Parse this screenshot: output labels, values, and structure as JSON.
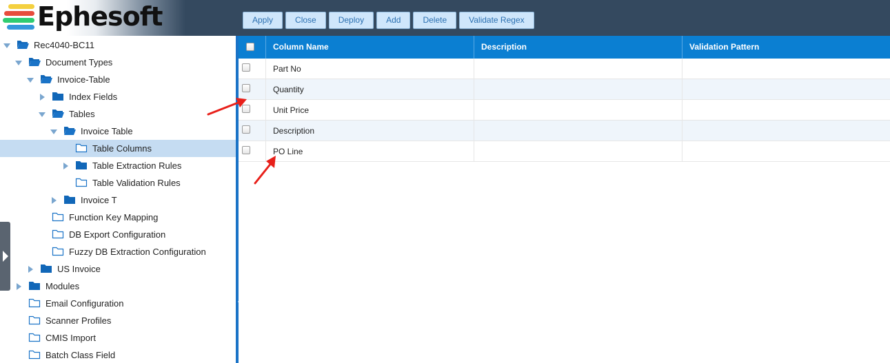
{
  "app": {
    "logo_text": "Ephesoft",
    "logo_colors": [
      "#f4d03f",
      "#e74c3c",
      "#2ecc71",
      "#3498db"
    ]
  },
  "toolbar": {
    "buttons": [
      "Apply",
      "Close",
      "Deploy",
      "Add",
      "Delete",
      "Validate Regex"
    ]
  },
  "tree": {
    "items": [
      {
        "label": "Rec4040-BC11",
        "level": 0,
        "state": "open"
      },
      {
        "label": "Document Types",
        "level": 1,
        "state": "open"
      },
      {
        "label": "Invoice-Table",
        "level": 2,
        "state": "open"
      },
      {
        "label": "Index Fields",
        "level": 3,
        "state": "closed"
      },
      {
        "label": "Tables",
        "level": 3,
        "state": "open"
      },
      {
        "label": "Invoice Table",
        "level": 4,
        "state": "open"
      },
      {
        "label": "Table Columns",
        "level": 5,
        "state": "leaf",
        "selected": true
      },
      {
        "label": "Table Extraction Rules",
        "level": 5,
        "state": "closed"
      },
      {
        "label": "Table Validation Rules",
        "level": 5,
        "state": "leaf"
      },
      {
        "label": "Invoice T",
        "level": 4,
        "state": "closed"
      },
      {
        "label": "Function Key Mapping",
        "level": 3,
        "state": "leaf"
      },
      {
        "label": "DB Export Configuration",
        "level": 3,
        "state": "leaf"
      },
      {
        "label": "Fuzzy DB Extraction Configuration",
        "level": 3,
        "state": "leaf"
      },
      {
        "label": "US Invoice",
        "level": 2,
        "state": "closed"
      },
      {
        "label": "Modules",
        "level": 1,
        "state": "closed"
      },
      {
        "label": "Email Configuration",
        "level": 1,
        "state": "leaf"
      },
      {
        "label": "Scanner Profiles",
        "level": 1,
        "state": "leaf"
      },
      {
        "label": "CMIS Import",
        "level": 1,
        "state": "leaf"
      },
      {
        "label": "Batch Class Field",
        "level": 1,
        "state": "leaf"
      }
    ]
  },
  "grid": {
    "columns": [
      "Column Name",
      "Description",
      "Validation Pattern"
    ],
    "rows": [
      {
        "name": "Part No",
        "description": "",
        "pattern": ""
      },
      {
        "name": "Quantity",
        "description": "",
        "pattern": ""
      },
      {
        "name": "Unit Price",
        "description": "",
        "pattern": ""
      },
      {
        "name": "Description",
        "description": "",
        "pattern": ""
      },
      {
        "name": "PO Line",
        "description": "",
        "pattern": ""
      }
    ]
  },
  "colors": {
    "header_bar": "#34495f",
    "grid_header": "#0b7fd2",
    "splitter": "#1a73c7",
    "selected_row": "#c5dcf2",
    "annotation_arrow": "#e8201a"
  }
}
